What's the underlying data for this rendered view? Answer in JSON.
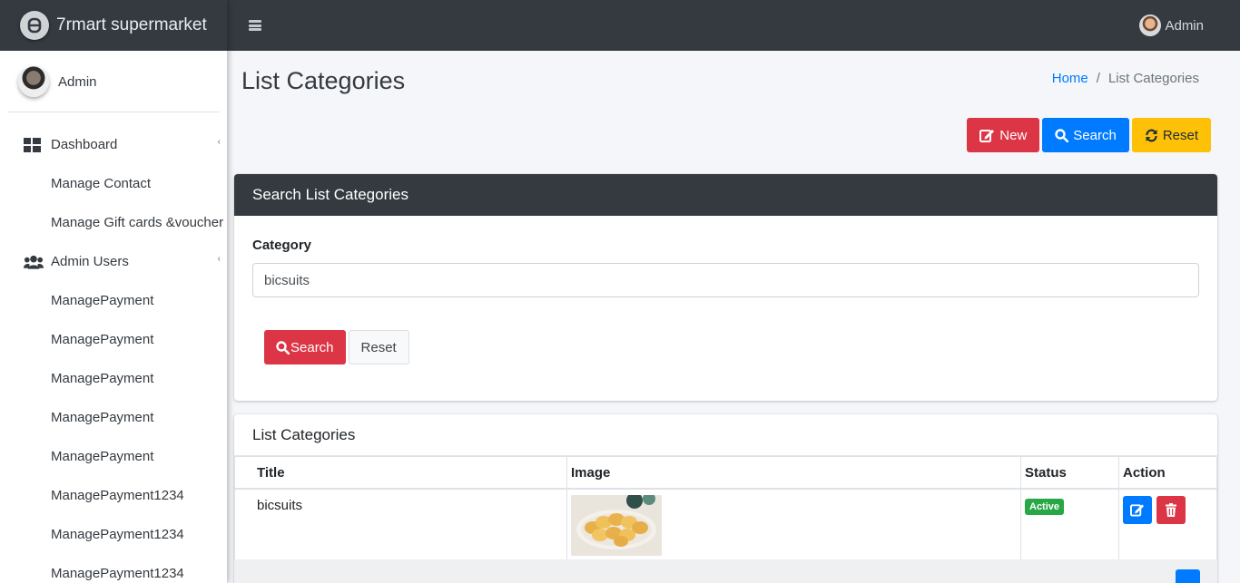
{
  "brand": {
    "name": "7rmart supermarket",
    "logo_icon": "brand-logo-icon"
  },
  "sidebar": {
    "user_name": "Admin",
    "items": [
      {
        "label": "Dashboard",
        "icon": "dashboard-grid-icon",
        "type": "parent"
      },
      {
        "label": "Manage Contact",
        "type": "child"
      },
      {
        "label": "Manage Gift cards &voucher",
        "type": "child"
      },
      {
        "label": "Admin Users",
        "icon": "users-icon",
        "type": "parent"
      },
      {
        "label": "ManagePayment",
        "type": "child"
      },
      {
        "label": "ManagePayment",
        "type": "child"
      },
      {
        "label": "ManagePayment",
        "type": "child"
      },
      {
        "label": "ManagePayment",
        "type": "child"
      },
      {
        "label": "ManagePayment",
        "type": "child"
      },
      {
        "label": "ManagePayment1234",
        "type": "child"
      },
      {
        "label": "ManagePayment1234",
        "type": "child"
      },
      {
        "label": "ManagePayment1234",
        "type": "child"
      }
    ]
  },
  "topbar": {
    "user_name": "Admin"
  },
  "page": {
    "title": "List Categories",
    "breadcrumb": {
      "home": "Home",
      "separator": "/",
      "current": "List Categories"
    }
  },
  "toolbar": {
    "new_label": "New",
    "search_label": "Search",
    "reset_label": "Reset"
  },
  "search_card": {
    "header": "Search List Categories",
    "category_label": "Category",
    "category_value": "bicsuits",
    "search_label": "Search",
    "reset_label": "Reset"
  },
  "list_card": {
    "header": "List Categories",
    "columns": [
      "Title",
      "Image",
      "Status",
      "Action"
    ],
    "rows": [
      {
        "title": "bicsuits",
        "image": "biscuits-plate-thumbnail",
        "status": "Active"
      }
    ]
  },
  "colors": {
    "danger": "#dc3545",
    "primary": "#007bff",
    "warning": "#ffc107",
    "success": "#28a745",
    "dark": "#343a40"
  }
}
